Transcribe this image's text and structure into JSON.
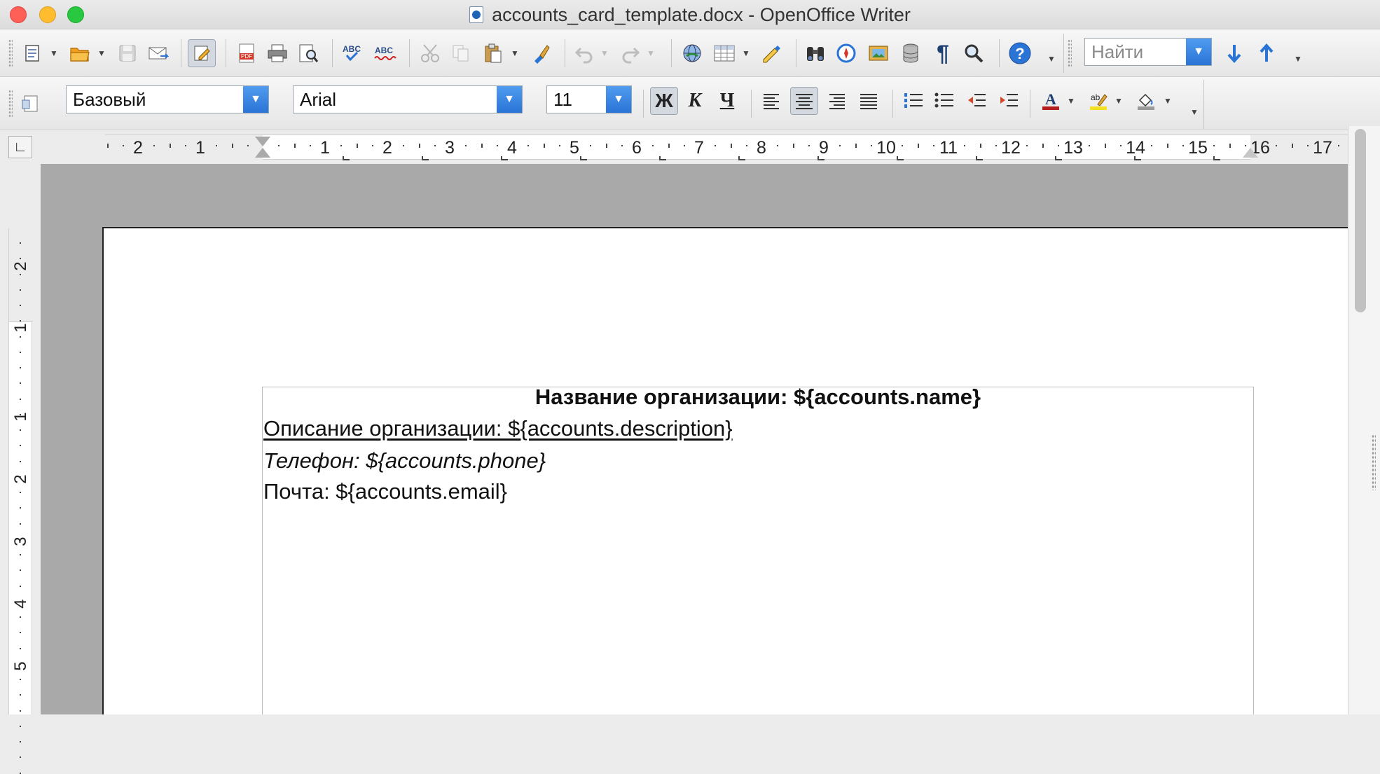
{
  "window": {
    "title": "accounts_card_template.docx - OpenOffice Writer"
  },
  "toolbar_standard": {
    "buttons": [
      {
        "name": "new-document",
        "icon": "new-document-icon"
      },
      {
        "name": "open",
        "icon": "folder-open-icon"
      },
      {
        "name": "save",
        "icon": "save-icon"
      },
      {
        "name": "email",
        "icon": "envelope-icon"
      },
      {
        "name": "edit-mode",
        "icon": "pencil-edit-icon"
      },
      {
        "name": "export-pdf",
        "icon": "pdf-icon"
      },
      {
        "name": "print",
        "icon": "printer-icon"
      },
      {
        "name": "print-preview",
        "icon": "print-preview-icon"
      },
      {
        "name": "spellcheck",
        "icon": "abc-check-icon"
      },
      {
        "name": "autospellcheck",
        "icon": "abc-underline-icon"
      },
      {
        "name": "cut",
        "icon": "scissors-icon"
      },
      {
        "name": "copy",
        "icon": "copy-icon"
      },
      {
        "name": "paste",
        "icon": "clipboard-icon"
      },
      {
        "name": "format-paintbrush",
        "icon": "paintbrush-icon"
      },
      {
        "name": "undo",
        "icon": "undo-icon"
      },
      {
        "name": "redo",
        "icon": "redo-icon"
      },
      {
        "name": "hyperlink",
        "icon": "globe-link-icon"
      },
      {
        "name": "table",
        "icon": "table-icon"
      },
      {
        "name": "draw-functions",
        "icon": "draw-pencil-icon"
      },
      {
        "name": "find-replace",
        "icon": "binoculars-icon"
      },
      {
        "name": "navigator",
        "icon": "compass-icon"
      },
      {
        "name": "gallery",
        "icon": "gallery-icon"
      },
      {
        "name": "data-sources",
        "icon": "database-icon"
      },
      {
        "name": "formatting-marks",
        "icon": "pilcrow-icon"
      },
      {
        "name": "zoom",
        "icon": "magnifier-icon"
      },
      {
        "name": "help",
        "icon": "help-icon"
      }
    ],
    "find_placeholder": "Найти"
  },
  "toolbar_formatting": {
    "paragraph_style": "Базовый",
    "font_name": "Arial",
    "font_size": "11",
    "bold_label": "Ж",
    "italic_label": "К",
    "underline_label": "Ч"
  },
  "ruler": {
    "horizontal_numbers": [
      "2",
      "1",
      "1",
      "2",
      "3",
      "4",
      "5",
      "6",
      "7",
      "8",
      "9",
      "10",
      "11",
      "12",
      "13",
      "14",
      "15",
      "16",
      "17"
    ],
    "vertical_numbers": [
      "2",
      "1",
      "1",
      "2",
      "3",
      "4",
      "5"
    ]
  },
  "document": {
    "lines": [
      {
        "text": "Название организации: ${accounts.name}",
        "style": "bold-center"
      },
      {
        "text": "Описание организации: ${accounts.description}",
        "style": "underline"
      },
      {
        "text": "Телефон: ${accounts.phone}",
        "style": "italic"
      },
      {
        "text": "Почта: ${accounts.email}",
        "style": "regular"
      }
    ]
  },
  "colors": {
    "accent_blue": "#2a74d6",
    "page_background": "#ffffff",
    "workspace_gray": "#a9a9a9",
    "close": "#fe5f57",
    "minimize": "#febc2e",
    "maximize": "#28c840"
  }
}
